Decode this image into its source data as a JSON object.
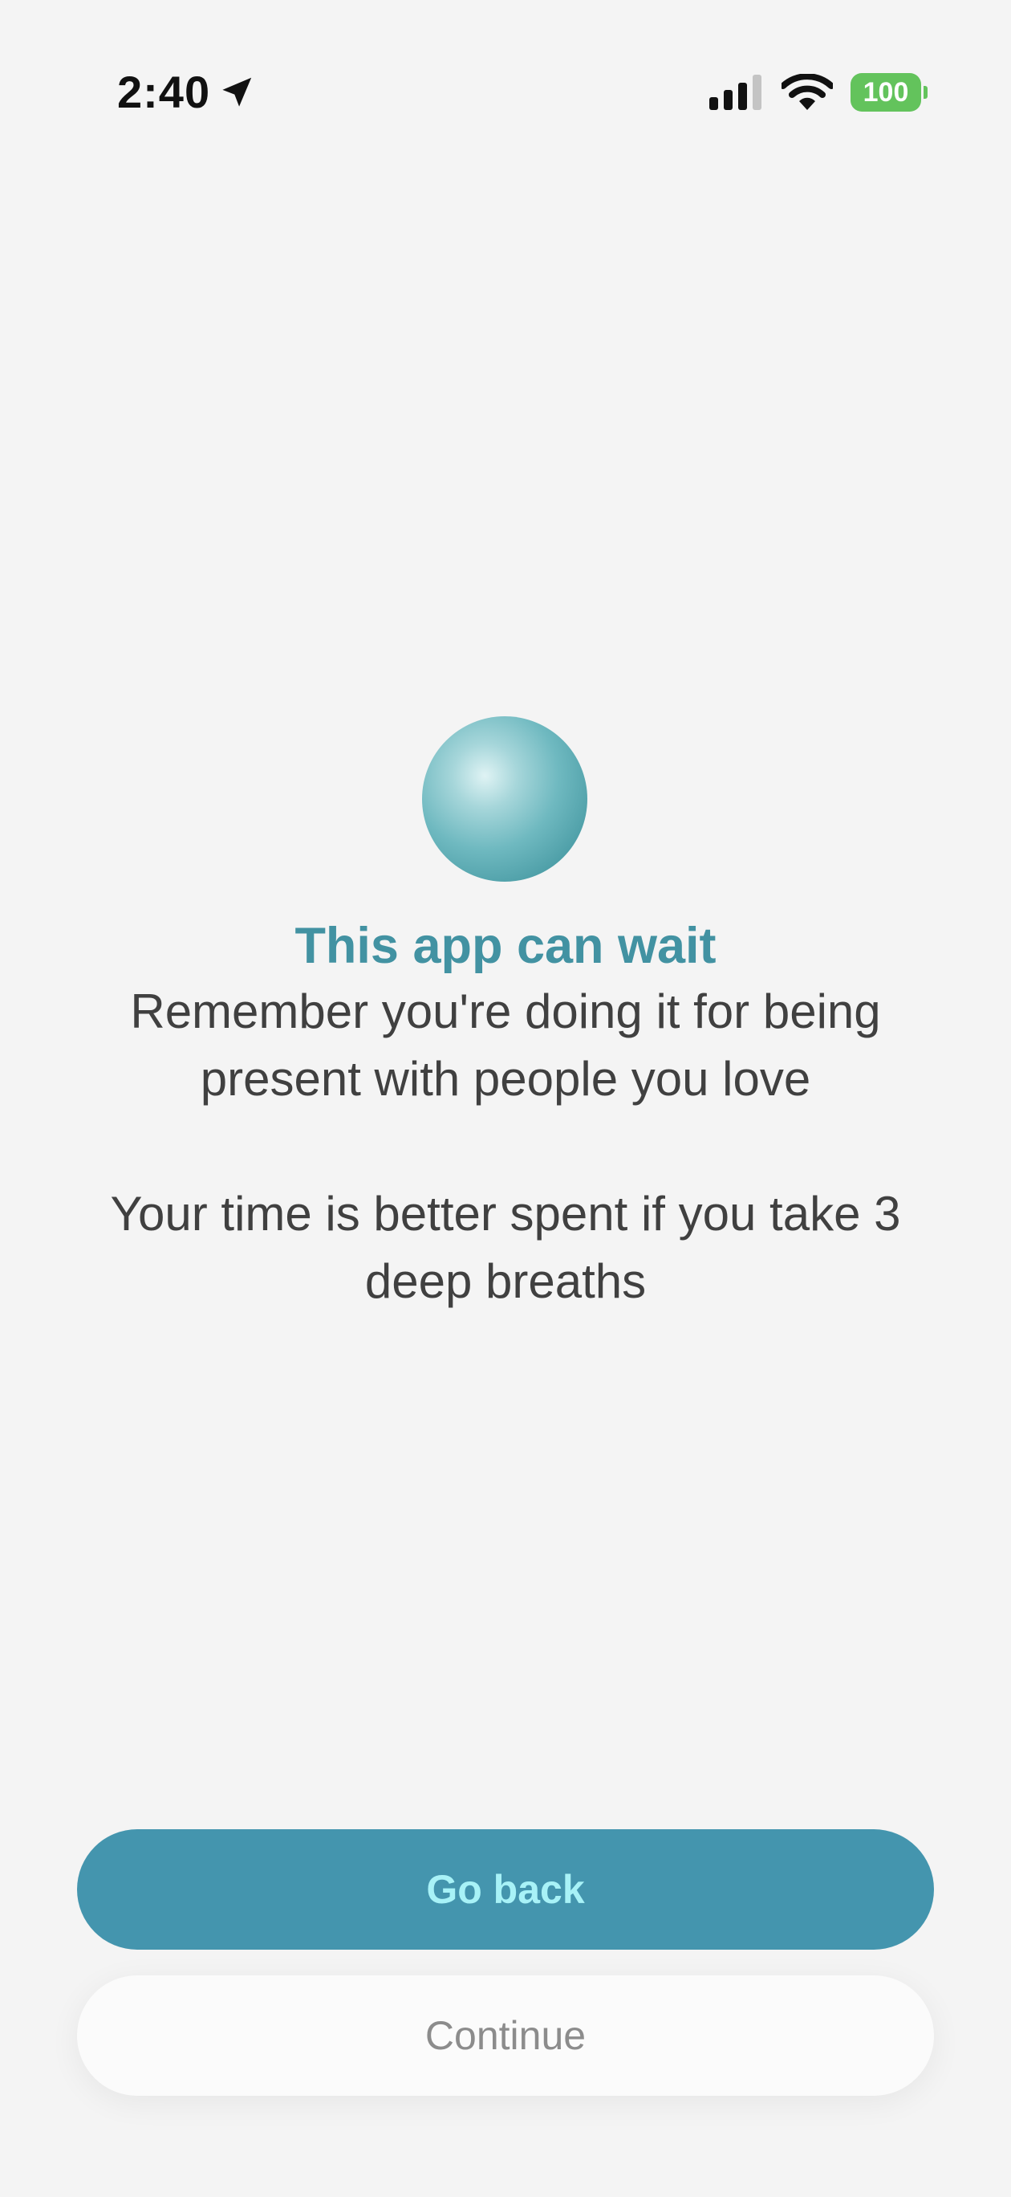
{
  "status_bar": {
    "time": "2:40",
    "location_icon": "location-arrow-icon",
    "signal_icon": "cellular-signal-icon",
    "wifi_icon": "wifi-icon",
    "battery_level": "100",
    "battery_color": "#63c35c"
  },
  "content": {
    "orb_icon": "breathing-orb",
    "title": "This app can wait",
    "message_1": "Remember you're doing it for being present with people you love",
    "message_2": "Your time is better spent if you take 3 deep breaths"
  },
  "buttons": {
    "primary_label": "Go back",
    "secondary_label": "Continue"
  },
  "colors": {
    "accent": "#4495ae",
    "title": "#4292a2",
    "primary_text": "#a8f2f7",
    "background": "#f4f4f4"
  }
}
